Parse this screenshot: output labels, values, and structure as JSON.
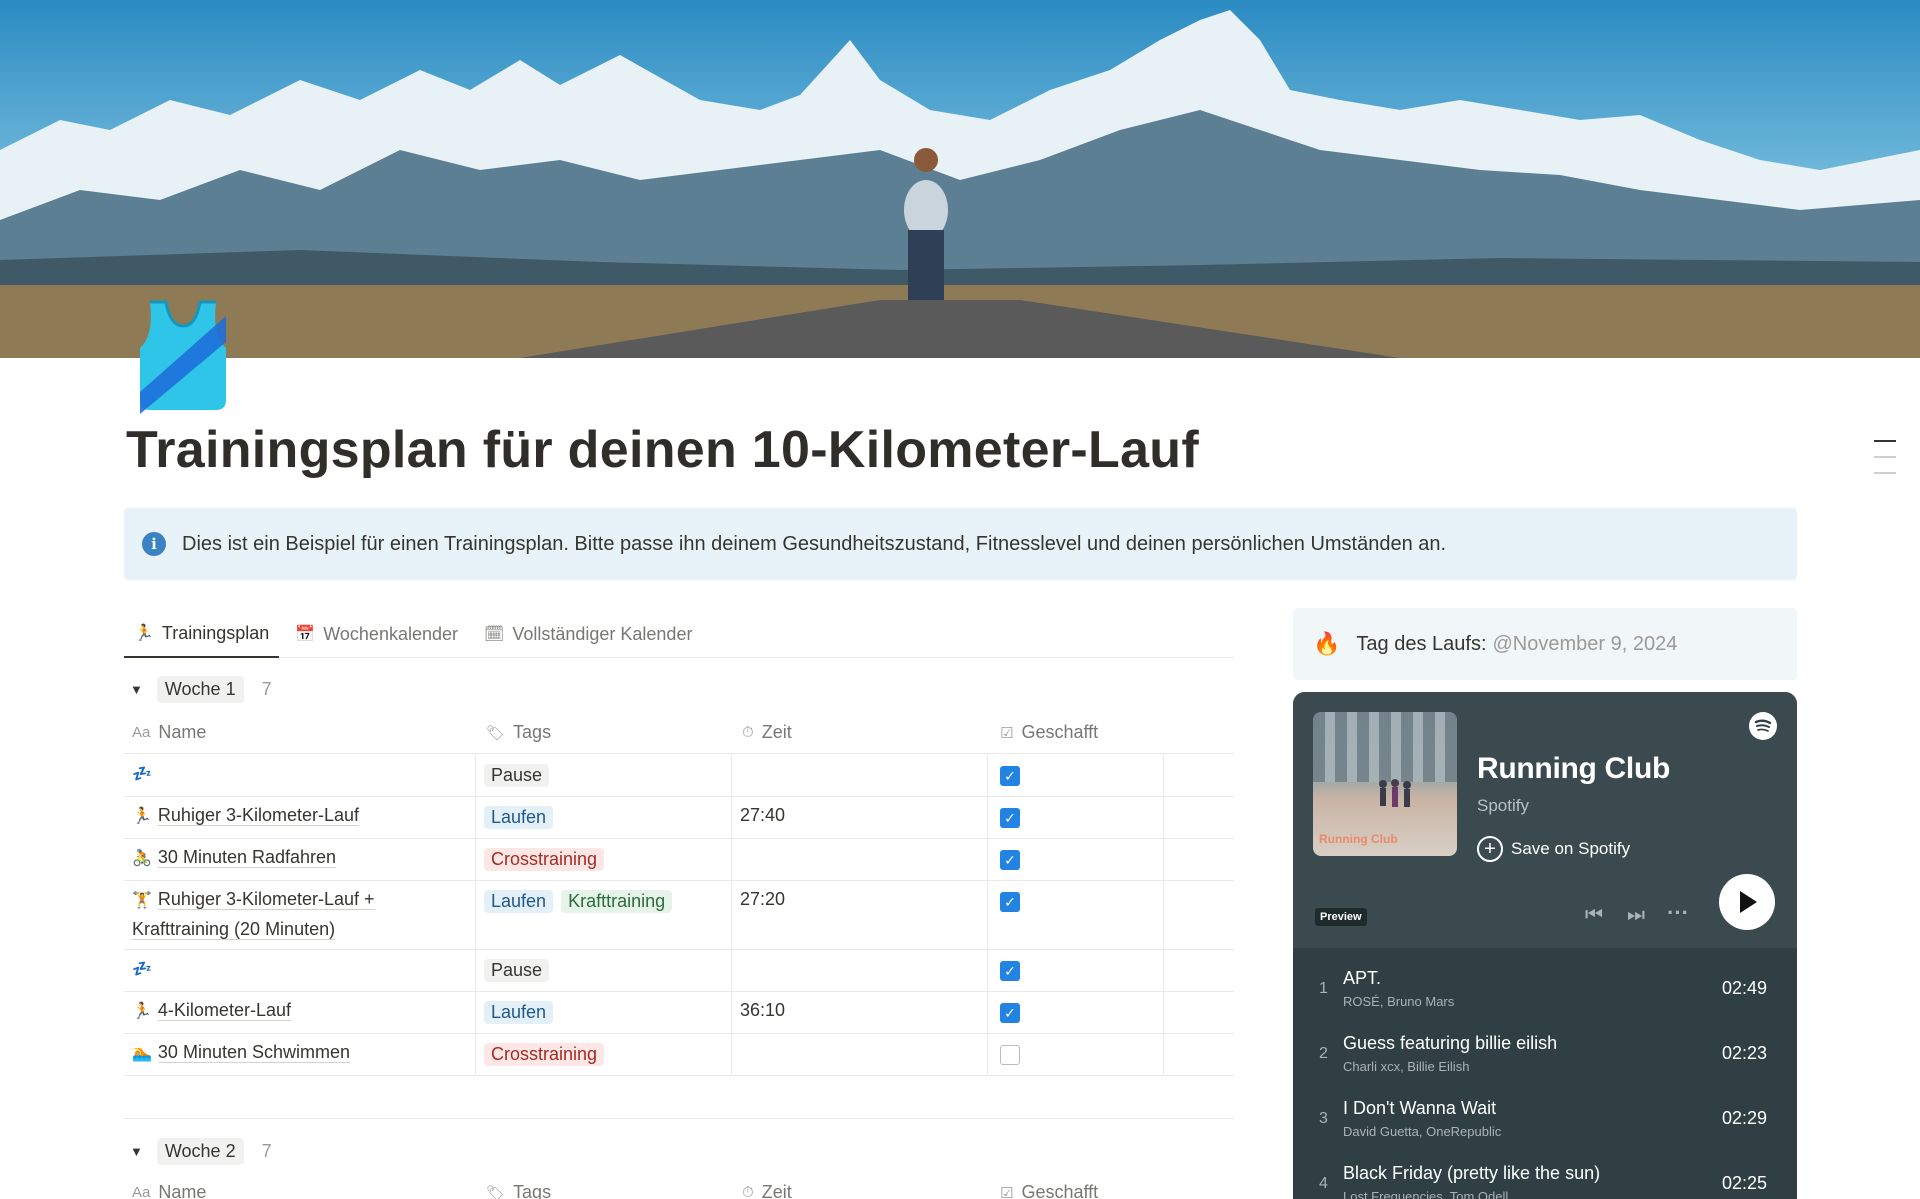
{
  "page": {
    "title": "Trainingsplan für deinen 10-Kilometer-Lauf",
    "callout": "Dies ist ein Beispiel für einen Trainingsplan. Bitte passe ihn deinem Gesundheitszustand, Fitnesslevel und deinen persönlichen Umständen an.",
    "icon": "running-shirt-icon"
  },
  "tabs": [
    {
      "label": "Trainingsplan",
      "icon": "running-person-icon",
      "active": true
    },
    {
      "label": "Wochenkalender",
      "icon": "calendar-icon",
      "active": false
    },
    {
      "label": "Vollständiger Kalender",
      "icon": "calendar-grid-icon",
      "active": false
    }
  ],
  "columns": {
    "name": "Name",
    "tags": "Tags",
    "time": "Zeit",
    "done": "Geschafft",
    "name_icon": "Aa"
  },
  "groups": [
    {
      "label": "Woche 1",
      "count": "7",
      "rows": [
        {
          "emoji": "💤",
          "name": "",
          "tags": [
            {
              "label": "Pause",
              "kind": "pause"
            }
          ],
          "time": "",
          "done": true
        },
        {
          "emoji": "🏃",
          "name": "Ruhiger 3-Kilometer-Lauf",
          "tags": [
            {
              "label": "Laufen",
              "kind": "laufen"
            }
          ],
          "time": "27:40",
          "done": true
        },
        {
          "emoji": "🚴",
          "name": "30 Minuten Radfahren",
          "tags": [
            {
              "label": "Crosstraining",
              "kind": "cross"
            }
          ],
          "time": "",
          "done": true
        },
        {
          "emoji": "🏋",
          "name": "Ruhiger 3-Kilometer-Lauf + Krafttraining (20 Minuten)",
          "tags": [
            {
              "label": "Laufen",
              "kind": "laufen"
            },
            {
              "label": "Krafttraining",
              "kind": "kraft"
            }
          ],
          "time": "27:20",
          "done": true
        },
        {
          "emoji": "💤",
          "name": "",
          "tags": [
            {
              "label": "Pause",
              "kind": "pause"
            }
          ],
          "time": "",
          "done": true
        },
        {
          "emoji": "🏃",
          "name": "4-Kilometer-Lauf",
          "tags": [
            {
              "label": "Laufen",
              "kind": "laufen"
            }
          ],
          "time": "36:10",
          "done": true
        },
        {
          "emoji": "🏊",
          "name": "30 Minuten Schwimmen",
          "tags": [
            {
              "label": "Crosstraining",
              "kind": "cross"
            }
          ],
          "time": "",
          "done": false
        }
      ]
    },
    {
      "label": "Woche 2",
      "count": "7",
      "rows": []
    }
  ],
  "race_day": {
    "label": "Tag des Laufs:",
    "date": "@November 9, 2024",
    "icon": "fire-icon"
  },
  "spotify": {
    "playlist": "Running Club",
    "provider": "Spotify",
    "save": "Save on Spotify",
    "preview": "Preview",
    "album_text": "Running Club",
    "tracks": [
      {
        "num": "1",
        "title": "APT.",
        "artist": "ROSÉ, Bruno Mars",
        "duration": "02:49"
      },
      {
        "num": "2",
        "title": "Guess featuring billie eilish",
        "artist": "Charli xcx, Billie Eilish",
        "duration": "02:23"
      },
      {
        "num": "3",
        "title": "I Don't Wanna Wait",
        "artist": "David Guetta, OneRepublic",
        "duration": "02:29"
      },
      {
        "num": "4",
        "title": "Black Friday (pretty like the sun)",
        "artist": "Lost Frequencies, Tom Odell",
        "duration": "02:25"
      }
    ]
  }
}
